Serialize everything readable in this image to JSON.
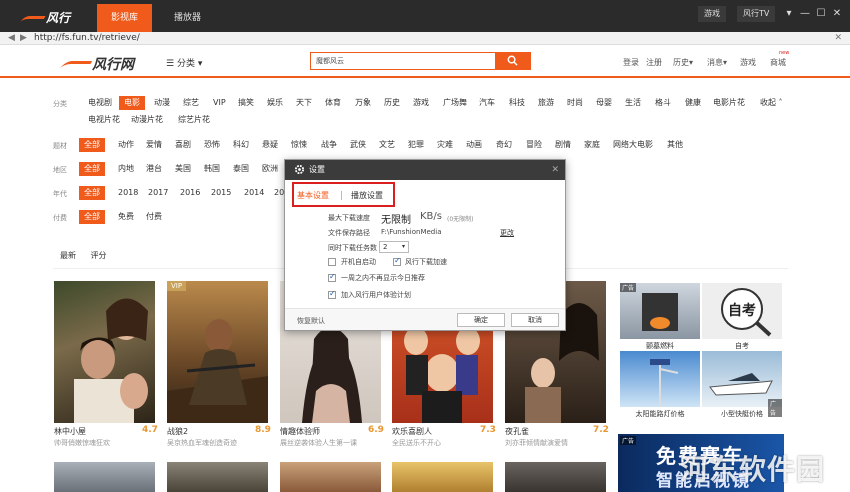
{
  "app": {
    "logo": "风行",
    "tabs": [
      "影视库",
      "播放器"
    ],
    "top_buttons": [
      "游戏",
      "风行TV"
    ],
    "window_controls": [
      "▾",
      "—",
      "☐",
      "✕"
    ]
  },
  "address": {
    "url": "http://fs.fun.tv/retrieve/",
    "close": "✕"
  },
  "site": {
    "logo": "风行网",
    "category_menu": "分类",
    "search_value": "魔都风云",
    "links": [
      "登录",
      "注册",
      "历史",
      "消息",
      "游戏",
      "商城"
    ],
    "new_badge": "new"
  },
  "filters": {
    "row1": {
      "label": "分类",
      "items": [
        "电视剧",
        "电影",
        "动漫",
        "综艺",
        "VIP",
        "搞笑",
        "娱乐",
        "天下",
        "体育",
        "万象",
        "历史",
        "游戏",
        "广场舞",
        "汽车",
        "科技",
        "旅游",
        "时尚",
        "母婴",
        "生活",
        "格斗",
        "健康",
        "电影片花"
      ],
      "items2": [
        "电视片花",
        "动漫片花",
        "综艺片花"
      ],
      "active": "电影",
      "collapse": "收起"
    },
    "row2": {
      "label": "题材",
      "items": [
        "全部",
        "动作",
        "爱情",
        "喜剧",
        "恐怖",
        "科幻",
        "悬疑",
        "惊悚",
        "战争",
        "武侠",
        "文艺",
        "犯罪",
        "灾难",
        "动画",
        "奇幻",
        "冒险",
        "剧情",
        "家庭",
        "网络大电影",
        "其他"
      ]
    },
    "row3": {
      "label": "地区",
      "items": [
        "全部",
        "内地",
        "港台",
        "美国",
        "韩国",
        "泰国",
        "欧洲"
      ]
    },
    "row4": {
      "label": "年代",
      "items": [
        "全部",
        "2018",
        "2017",
        "2016",
        "2015",
        "2014",
        "201"
      ]
    },
    "row5": {
      "label": "付费",
      "items": [
        "全部",
        "免费",
        "付费"
      ]
    }
  },
  "sort_tabs": [
    "最新",
    "评分"
  ],
  "posters": [
    {
      "title": "林中小屋",
      "sub": "帅哥俏嫩惊魂狂欢",
      "score": "4.7",
      "vip": ""
    },
    {
      "title": "战狼2",
      "sub": "吴京热血军魂创造奇迹",
      "score": "8.9",
      "vip": "VIP"
    },
    {
      "title": "情趣体验师",
      "sub": "展丝逆袭体验人生第一课",
      "score": "6.9",
      "vip": ""
    },
    {
      "title": "欢乐喜剧人",
      "sub": "全民送乐不开心",
      "score": "7.3",
      "vip": ""
    },
    {
      "title": "夜孔雀",
      "sub": "刘亦菲倾情献演爱情",
      "score": "7.2",
      "vip": ""
    }
  ],
  "ads": {
    "tag": "广告",
    "items": [
      "颤墓燃料",
      "自考",
      "太阳能路灯价格",
      "小型快艇价格"
    ],
    "banner_line1": "免费赛车",
    "banner_line2": "智能启视镜",
    "watermark": "河东软件园"
  },
  "dialog": {
    "title": "设置",
    "tabs": [
      "基本设置",
      "播放设置"
    ],
    "max_speed_label": "最大下载速度",
    "max_speed_value": "无限制",
    "max_speed_unit": "KB/s",
    "max_speed_hint": "(0无限制)",
    "save_path_label": "文件保存路径",
    "save_path_value": "F:\\FunshionMedia",
    "change_link": "更改",
    "concurrent_label": "同时下载任务数",
    "concurrent_value": "2",
    "options": [
      {
        "label": "开机自启动",
        "checked": false
      },
      {
        "label": "风行下载加速",
        "checked": true
      },
      {
        "label": "一周之内不再显示今日推荐",
        "checked": true
      },
      {
        "label": "加入风行用户体验计划",
        "checked": true
      }
    ],
    "restore": "恢复默认",
    "ok": "确定",
    "cancel": "取消",
    "accent": "#f05a1a",
    "highlight": "#d9201e"
  }
}
